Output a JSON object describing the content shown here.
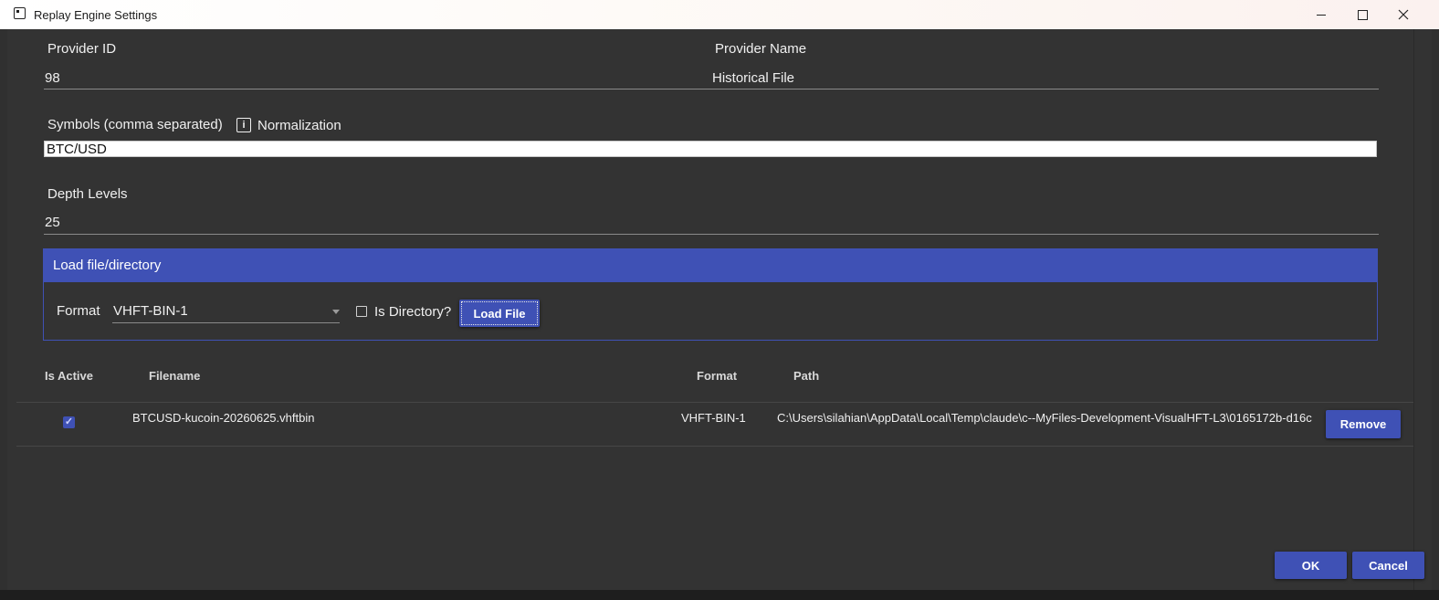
{
  "window": {
    "title": "Replay Engine Settings",
    "controls": {
      "minimize": "minimize-icon",
      "maximize": "maximize-icon",
      "close": "close-icon"
    }
  },
  "form": {
    "provider_id_label": "Provider ID",
    "provider_id_value": "98",
    "provider_name_label": "Provider Name",
    "provider_name_value": "Historical File",
    "symbols_label": "Symbols (comma separated)",
    "normalization_label": "Normalization",
    "normalization_icon": "i",
    "symbols_value": "BTC/USD",
    "depth_label": "Depth Levels",
    "depth_value": "25"
  },
  "load_group": {
    "header": "Load file/directory",
    "format_label": "Format",
    "format_selected": "VHFT-BIN-1",
    "is_directory_label": "Is Directory?",
    "is_directory_checked": false,
    "load_button": "Load File"
  },
  "table": {
    "headers": [
      "Is Active",
      "Filename",
      "Format",
      "Path"
    ],
    "rows": [
      {
        "is_active": true,
        "filename": "BTCUSD-kucoin-20260625.vhftbin",
        "format": "VHFT-BIN-1",
        "path": "C:\\Users\\silahian\\AppData\\Local\\Temp\\claude\\c--MyFiles-Development-VisualHFT-L3\\0165172b-d16c",
        "remove_label": "Remove"
      }
    ]
  },
  "footer": {
    "ok_label": "OK",
    "cancel_label": "Cancel"
  },
  "colors": {
    "accent": "#3f51b5",
    "background": "#333333",
    "text": "#f0f0f0"
  }
}
